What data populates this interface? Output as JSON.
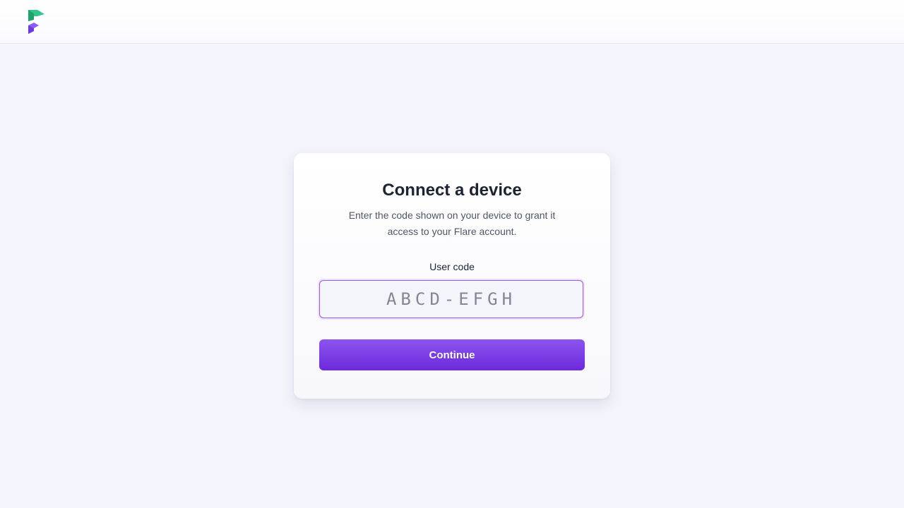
{
  "header": {
    "logo_icon": "flare-logo-icon",
    "logo_colors": [
      "#2fbf7a",
      "#8b5cf6"
    ]
  },
  "card": {
    "title": "Connect a device",
    "subtitle": "Enter the code shown on your device to grant it access to your Flare account.",
    "field_label": "User code",
    "code_input": {
      "value": "",
      "placeholder": "ABCD-EFGH"
    },
    "continue_label": "Continue"
  },
  "colors": {
    "accent": "#7c3aed",
    "background": "#f3f4fc"
  }
}
